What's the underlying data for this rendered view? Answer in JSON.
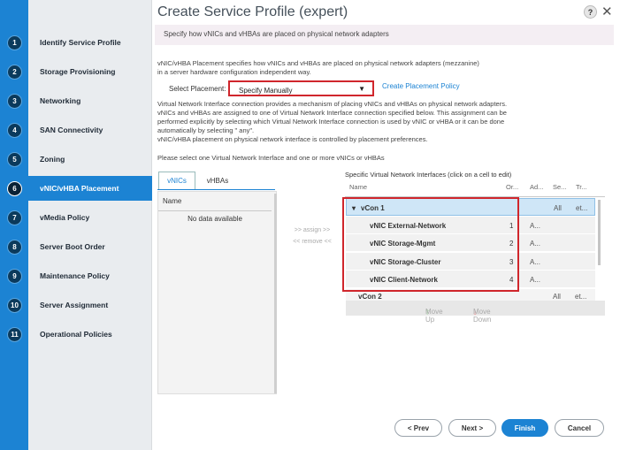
{
  "wizard": {
    "title": "Create Service Profile (expert)",
    "help_label": "?",
    "close_label": "✕",
    "subtitle": "Specify how vNICs and vHBAs are placed on physical network adapters",
    "steps": [
      {
        "num": "1",
        "label": "Identify Service Profile"
      },
      {
        "num": "2",
        "label": "Storage Provisioning"
      },
      {
        "num": "3",
        "label": "Networking"
      },
      {
        "num": "4",
        "label": "SAN Connectivity"
      },
      {
        "num": "5",
        "label": "Zoning"
      },
      {
        "num": "6",
        "label": "vNIC/vHBA Placement"
      },
      {
        "num": "7",
        "label": "vMedia Policy"
      },
      {
        "num": "8",
        "label": "Server Boot Order"
      },
      {
        "num": "9",
        "label": "Maintenance Policy"
      },
      {
        "num": "10",
        "label": "Server Assignment"
      },
      {
        "num": "11",
        "label": "Operational Policies"
      }
    ]
  },
  "content": {
    "intro_lines": [
      "vNIC/vHBA Placement specifies how vNICs and vHBAs are placed on physical network adapters (mezzanine)",
      "in a server hardware configuration independent way."
    ],
    "select_placement_label": "Select Placement:",
    "select_placement_value": "Specify Manually",
    "create_placement_policy": "Create Placement Policy",
    "info_lines": [
      "Virtual Network Interface connection provides a mechanism of placing vNICs and vHBAs on physical network adapters.",
      "vNICs and vHBAs are assigned to one of Virtual Network Interface connection specified below. This assignment can be",
      "performed explicitly by selecting which Virtual Network Interface connection is used by vNIC or vHBA or it can be done",
      "automatically by selecting \" any\".",
      "vNIC/vHBA placement on physical network interface is controlled by placement preferences."
    ],
    "instruction": "Please select one Virtual Network Interface and one or more vNICs or vHBAs"
  },
  "left_panel": {
    "tabs": [
      "vNICs",
      "vHBAs"
    ],
    "column_name": "Name",
    "empty_text": "No data available"
  },
  "assign_label": ">> assign >>",
  "remove_label": "<< remove <<",
  "right_panel": {
    "title": "Specific Virtual Network Interfaces (click on a cell to edit)",
    "columns": [
      "Name",
      "Or...",
      "Ad...",
      "Se...",
      "Tr..."
    ],
    "groups": [
      {
        "name": "vCon 1",
        "se": "All",
        "tr": "et..."
      },
      {
        "name": "vCon 2",
        "se": "All",
        "tr": "et..."
      }
    ],
    "children": [
      {
        "name": "vNIC External-Network",
        "order": "1",
        "admin": "A..."
      },
      {
        "name": "vNIC Storage-Mgmt",
        "order": "2",
        "admin": "A..."
      },
      {
        "name": "vNIC Storage-Cluster",
        "order": "3",
        "admin": "A..."
      },
      {
        "name": "vNIC Client-Network",
        "order": "4",
        "admin": "A..."
      }
    ],
    "move_up": "Move Up",
    "move_down": "Move Down"
  },
  "footer": {
    "prev": "< Prev",
    "next": "Next >",
    "finish": "Finish",
    "cancel": "Cancel"
  }
}
